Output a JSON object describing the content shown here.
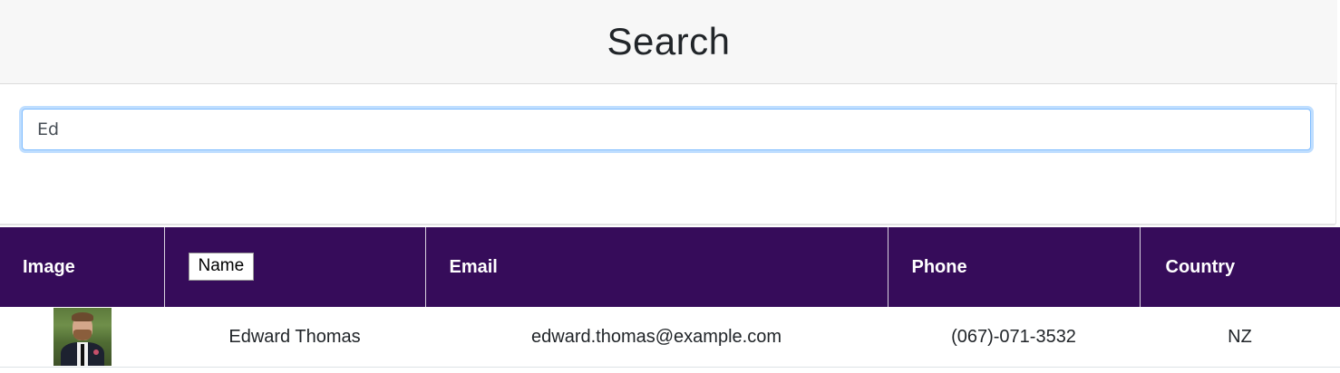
{
  "header": {
    "title": "Search"
  },
  "search": {
    "value": "Ed"
  },
  "table": {
    "columns": {
      "image": "Image",
      "name": "Name",
      "email": "Email",
      "phone": "Phone",
      "country": "Country"
    },
    "rows": [
      {
        "image_icon": "user-photo",
        "name": "Edward Thomas",
        "email": "edward.thomas@example.com",
        "phone": "(067)-071-3532",
        "country": "NZ"
      }
    ]
  },
  "colors": {
    "table_header_bg": "#360c5a",
    "page_header_bg": "#f7f7f7",
    "input_focus_border": "#80bdff"
  }
}
